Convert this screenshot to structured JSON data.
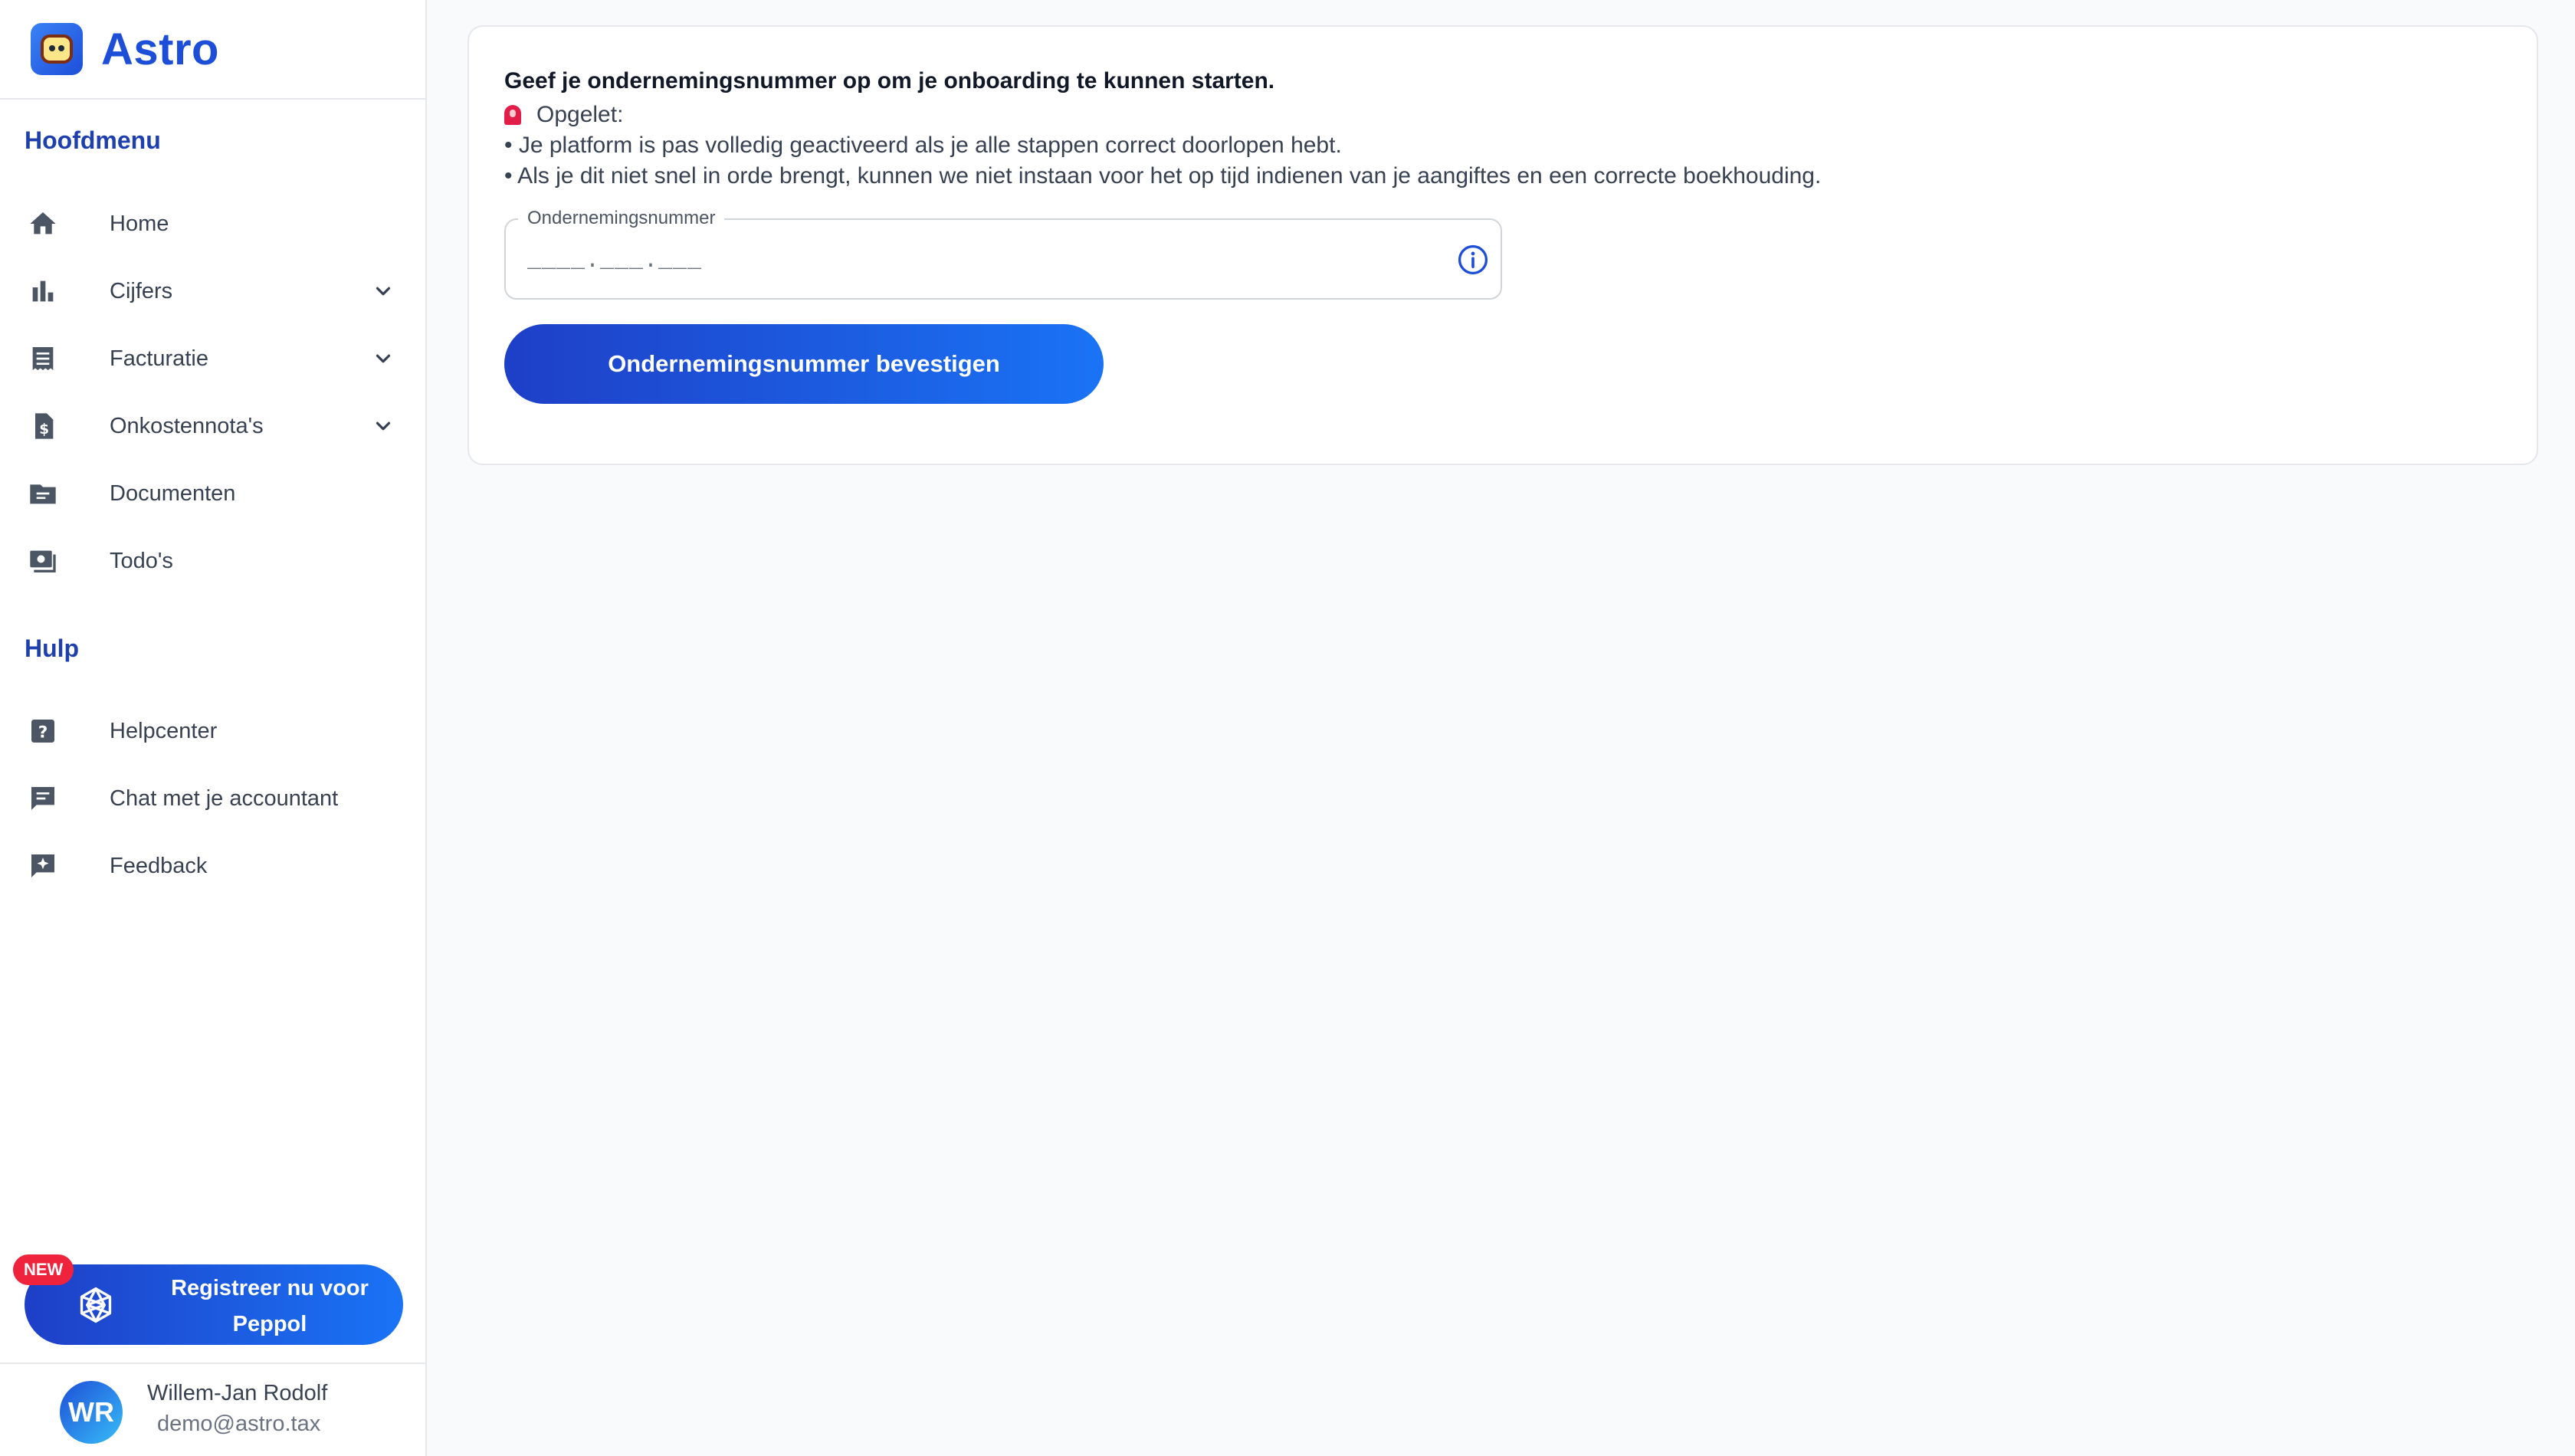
{
  "brand": {
    "name": "Astro"
  },
  "sidebar": {
    "main_title": "Hoofdmenu",
    "main_items": [
      {
        "label": "Home",
        "icon": "home-icon",
        "expandable": false
      },
      {
        "label": "Cijfers",
        "icon": "bar-chart-icon",
        "expandable": true
      },
      {
        "label": "Facturatie",
        "icon": "receipt-icon",
        "expandable": true
      },
      {
        "label": "Onkostennota's",
        "icon": "expense-file-icon",
        "expandable": true
      },
      {
        "label": "Documenten",
        "icon": "folder-icon",
        "expandable": false
      },
      {
        "label": "Todo's",
        "icon": "todo-icon",
        "expandable": false
      }
    ],
    "help_title": "Hulp",
    "help_items": [
      {
        "label": "Helpcenter",
        "icon": "help-icon"
      },
      {
        "label": "Chat met je accountant",
        "icon": "chat-icon"
      },
      {
        "label": "Feedback",
        "icon": "feedback-icon"
      }
    ],
    "peppol": {
      "badge": "NEW",
      "label": "Registreer nu voor Peppol"
    },
    "user": {
      "initials": "WR",
      "name": "Willem-Jan Rodolf",
      "email": "demo@astro.tax"
    }
  },
  "main": {
    "heading": "Geef je ondernemingsnummer op om je onboarding te kunnen starten.",
    "warning": "Opgelet:",
    "bullets": [
      "• Je platform is pas volledig geactiveerd als je alle stappen correct doorlopen hebt.",
      "• Als je dit niet snel in orde brengt, kunnen we niet instaan voor het op tijd indienen van je aangiftes en een correcte boekhouding."
    ],
    "field": {
      "label": "Ondernemingsnummer",
      "placeholder": "____.___.___",
      "value": ""
    },
    "confirm_label": "Ondernemingsnummer bevestigen"
  },
  "colors": {
    "primary": "#1d4ed8",
    "accent_start": "#1e3fc7",
    "accent_end": "#1a73f5",
    "badge": "#ef233c",
    "background": "#f8fafc"
  }
}
